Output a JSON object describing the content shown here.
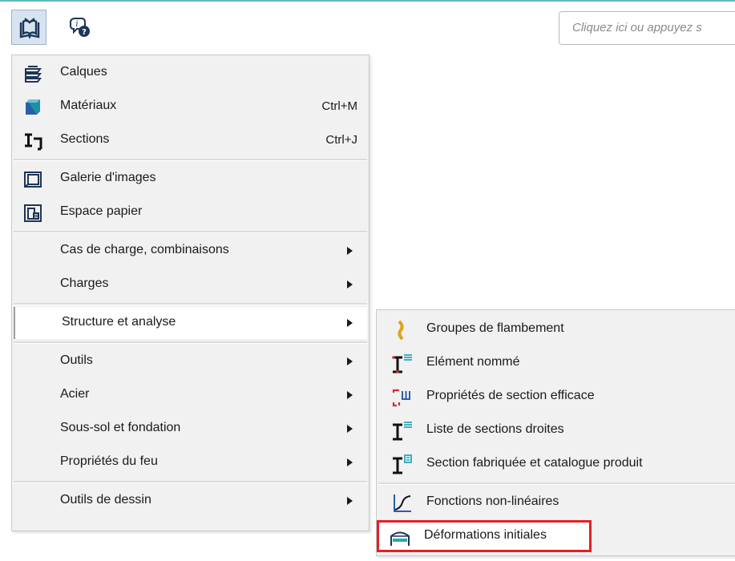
{
  "toolbar": {
    "search_placeholder": "Cliquez ici ou appuyez s",
    "icons": [
      "book-menu-icon",
      "info-help-icon"
    ]
  },
  "menu": {
    "items": [
      {
        "label": "Calques",
        "icon": "layers-icon"
      },
      {
        "label": "Matériaux",
        "shortcut": "Ctrl+M",
        "icon": "materials-icon"
      },
      {
        "label": "Sections",
        "shortcut": "Ctrl+J",
        "icon": "sections-icon"
      },
      {
        "label": "Galerie d'images",
        "icon": "image-gallery-icon"
      },
      {
        "label": "Espace papier",
        "icon": "paper-space-icon"
      },
      {
        "label": "Cas de charge, combinaisons"
      },
      {
        "label": "Charges"
      },
      {
        "label": "Structure et analyse"
      },
      {
        "label": "Outils"
      },
      {
        "label": "Acier"
      },
      {
        "label": "Sous-sol et fondation"
      },
      {
        "label": "Propriétés du feu"
      },
      {
        "label": "Outils de dessin"
      }
    ]
  },
  "submenu": {
    "items": [
      {
        "label": "Groupes de flambement",
        "icon": "buckling-icon"
      },
      {
        "label": "Elément nommé",
        "icon": "named-element-icon"
      },
      {
        "label": "Propriétés de section efficace",
        "icon": "effective-section-icon"
      },
      {
        "label": "Liste de sections droites",
        "icon": "section-list-icon"
      },
      {
        "label": "Section fabriquée et catalogue produit",
        "icon": "fabricated-section-icon"
      },
      {
        "label": "Fonctions non-linéaires",
        "icon": "nonlinear-function-icon"
      },
      {
        "label": "Déformations initiales",
        "icon": "initial-deformation-icon"
      }
    ]
  },
  "colors": {
    "highlight_border": "#e32026",
    "menu_bg": "#f1f1f1",
    "toolbar_accent": "#5fb8c9"
  }
}
